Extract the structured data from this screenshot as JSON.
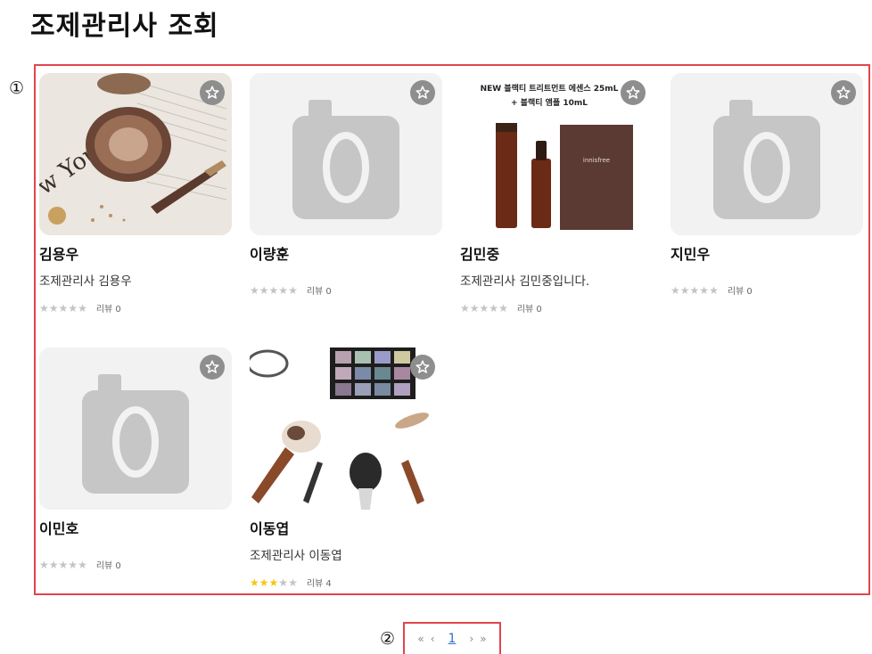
{
  "page": {
    "title": "조제관리사 조회"
  },
  "markers": {
    "first": "①",
    "second": "②"
  },
  "cards": [
    {
      "name": "김용우",
      "description": "조제관리사 김용우",
      "rating": 0,
      "review_text": "리뷰 0",
      "image": "cosmetics-compact-photo"
    },
    {
      "name": "이량훈",
      "description": "",
      "rating": 0,
      "review_text": "리뷰 0",
      "image": "camera-placeholder"
    },
    {
      "name": "김민중",
      "description": "조제관리사 김민중입니다.",
      "rating": 0,
      "review_text": "리뷰 0",
      "image": "serum-product-photo",
      "image_caption_1": "NEW 블랙티 트리트먼트 에센스 25mL",
      "image_caption_2": "+ 블랙티 앰플 10mL",
      "product_brand": "innisfree"
    },
    {
      "name": "지민우",
      "description": "",
      "rating": 0,
      "review_text": "리뷰 0",
      "image": "camera-placeholder"
    },
    {
      "name": "이민호",
      "description": "",
      "rating": 0,
      "review_text": "리뷰 0",
      "image": "camera-placeholder"
    },
    {
      "name": "이동엽",
      "description": "조제관리사 이동엽",
      "rating": 3,
      "review_text": "리뷰 4",
      "image": "makeup-brushes-photo"
    }
  ],
  "pagination": {
    "first": "«",
    "prev": "‹",
    "current": "1",
    "next": "›",
    "last": "»"
  },
  "icons": {
    "favorite": "star-outline-icon",
    "placeholder": "camera-icon",
    "rating": "star-icon"
  },
  "colors": {
    "highlight_border": "#e2454c",
    "star_on": "#f4c811",
    "star_off": "#c4c4c4",
    "link": "#2f6fd6"
  }
}
